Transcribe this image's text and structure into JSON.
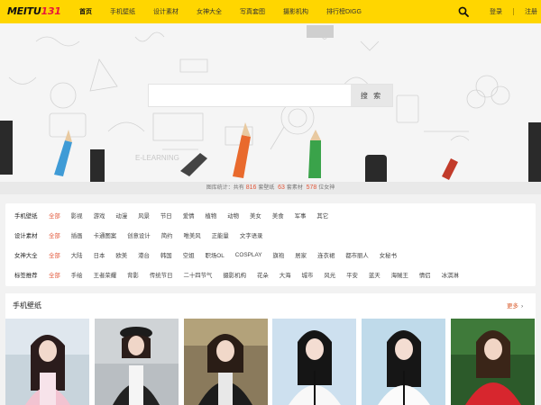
{
  "logo": {
    "text_a": "MEITU",
    "text_b": "131"
  },
  "nav": [
    "首页",
    "手机壁纸",
    "设计素材",
    "女神大全",
    "写真套图",
    "摄影机构",
    "排行榜DIGG"
  ],
  "user": {
    "login": "登录",
    "register": "注册"
  },
  "search": {
    "value": "",
    "placeholder": "",
    "button": "搜 索"
  },
  "stats": {
    "prefix": "图库统计：共有",
    "sets_count": "816",
    "sets_label": "套壁纸",
    "material_count": "63",
    "material_label": "套素材",
    "people_count": "578",
    "people_label": "位女神"
  },
  "categories": [
    {
      "title": "手机壁纸",
      "items": [
        "全部",
        "影视",
        "游戏",
        "动漫",
        "风景",
        "节日",
        "爱情",
        "植物",
        "动物",
        "美女",
        "美食",
        "军事",
        "其它"
      ]
    },
    {
      "title": "设计素材",
      "items": [
        "全部",
        "插画",
        "卡通图案",
        "创意设计",
        "简约",
        "唯美风",
        "正能量",
        "文字语录"
      ]
    },
    {
      "title": "女神大全",
      "items": [
        "全部",
        "大陆",
        "日本",
        "欧美",
        "港台",
        "韩国",
        "空姐",
        "职场OL",
        "COSPLAY",
        "旗袍",
        "居家",
        "连衣裙",
        "都市丽人",
        "女秘书"
      ]
    },
    {
      "title": "标签推荐",
      "items": [
        "全部",
        "手绘",
        "王者荣耀",
        "背影",
        "传统节日",
        "二十四节气",
        "摄影机构",
        "花朵",
        "大海",
        "城市",
        "风光",
        "平安",
        "蓝天",
        "海贼王",
        "情侣",
        "冰淇淋"
      ]
    }
  ],
  "section": {
    "title": "手机壁纸",
    "more": "更多"
  },
  "colors": {
    "brand": "#ffd600",
    "accent": "#e2573a"
  },
  "icons": {
    "search": "search-icon",
    "more": "chevron-right-icon"
  }
}
